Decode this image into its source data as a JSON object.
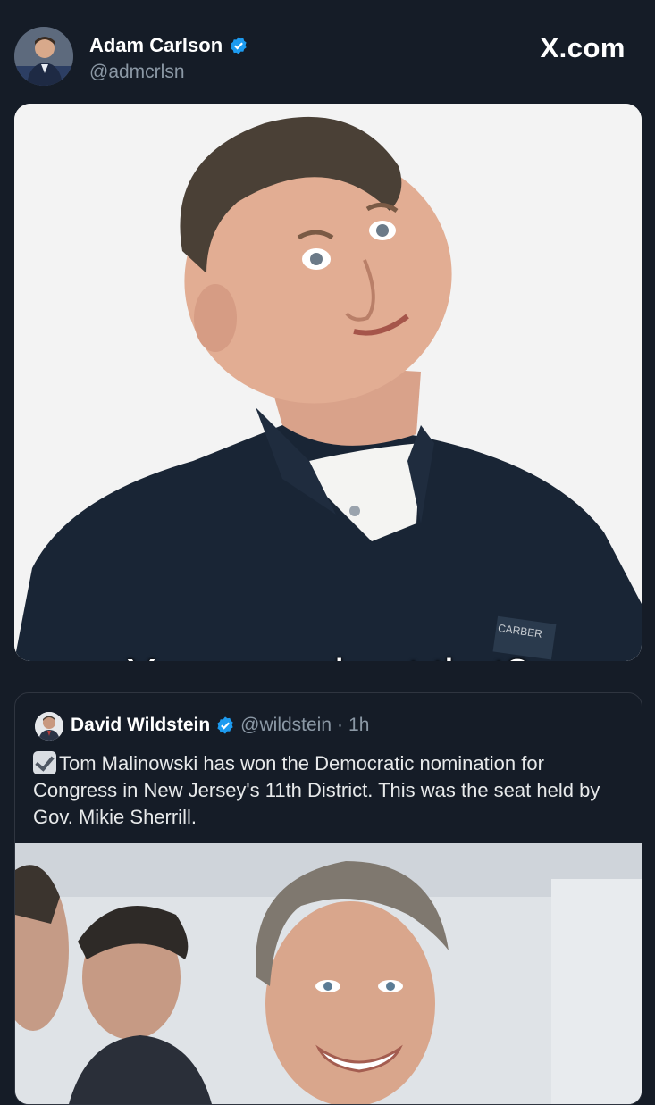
{
  "header": {
    "author_name": "Adam Carlson",
    "author_handle": "@admcrlsn",
    "brand": "X.com"
  },
  "meme": {
    "caption": "You sure about that?"
  },
  "quoted_post": {
    "author_name": "David Wildstein",
    "author_handle": "@wildstein",
    "separator": "·",
    "time": "1h",
    "text": "Tom Malinowski has won the Democratic nomination for Congress in New Jersey's 11th District.  This was the seat held by Gov. Mikie Sherrill."
  },
  "icons": {
    "verified": "verified-badge-icon",
    "check": "check-mark-emoji-icon"
  },
  "colors": {
    "background": "#151c27",
    "verified_blue": "#1d9bf0",
    "secondary_text": "#8b98a5"
  }
}
